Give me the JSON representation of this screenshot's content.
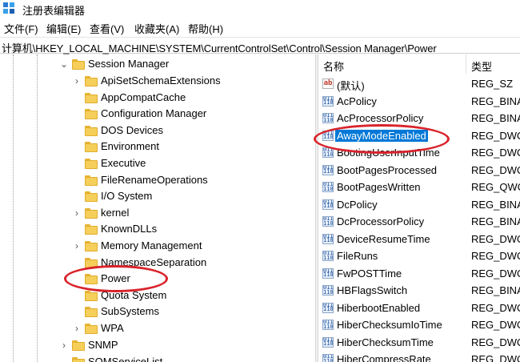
{
  "window": {
    "title": "注册表编辑器"
  },
  "menu": [
    "文件(F)",
    "编辑(E)",
    "查看(V)",
    "收藏夹(A)",
    "帮助(H)"
  ],
  "address": "计算机\\HKEY_LOCAL_MACHINE\\SYSTEM\\CurrentControlSet\\Control\\Session Manager\\Power",
  "tree": {
    "parent": "Session Manager",
    "children": [
      {
        "label": "ApiSetSchemaExtensions",
        "expandable": true
      },
      {
        "label": "AppCompatCache",
        "expandable": false
      },
      {
        "label": "Configuration Manager",
        "expandable": false
      },
      {
        "label": "DOS Devices",
        "expandable": false
      },
      {
        "label": "Environment",
        "expandable": false
      },
      {
        "label": "Executive",
        "expandable": false
      },
      {
        "label": "FileRenameOperations",
        "expandable": false
      },
      {
        "label": "I/O System",
        "expandable": false
      },
      {
        "label": "kernel",
        "expandable": true
      },
      {
        "label": "KnownDLLs",
        "expandable": false
      },
      {
        "label": "Memory Management",
        "expandable": true
      },
      {
        "label": "NamespaceSeparation",
        "expandable": false
      },
      {
        "label": "Power",
        "expandable": false
      },
      {
        "label": "Quota System",
        "expandable": false
      },
      {
        "label": "SubSystems",
        "expandable": false
      },
      {
        "label": "WPA",
        "expandable": true
      }
    ],
    "siblings": [
      "SNMP",
      "SQMServiceList"
    ]
  },
  "values": {
    "headers": {
      "name": "名称",
      "type": "类型"
    },
    "rows": [
      {
        "name": "(默认)",
        "type": "REG_SZ",
        "icon": "string-value-icon"
      },
      {
        "name": "AcPolicy",
        "type": "REG_BINA",
        "icon": "binary-value-icon"
      },
      {
        "name": "AcProcessorPolicy",
        "type": "REG_BINA",
        "icon": "binary-value-icon"
      },
      {
        "name": "AwayModeEnabled",
        "type": "REG_DWO",
        "icon": "binary-value-icon",
        "selected": true
      },
      {
        "name": "BootingUserInputTime",
        "type": "REG_DWO",
        "icon": "binary-value-icon"
      },
      {
        "name": "BootPagesProcessed",
        "type": "REG_DWO",
        "icon": "binary-value-icon"
      },
      {
        "name": "BootPagesWritten",
        "type": "REG_QWO",
        "icon": "binary-value-icon"
      },
      {
        "name": "DcPolicy",
        "type": "REG_BINA",
        "icon": "binary-value-icon"
      },
      {
        "name": "DcProcessorPolicy",
        "type": "REG_BINA",
        "icon": "binary-value-icon"
      },
      {
        "name": "DeviceResumeTime",
        "type": "REG_DWO",
        "icon": "binary-value-icon"
      },
      {
        "name": "FileRuns",
        "type": "REG_DWO",
        "icon": "binary-value-icon"
      },
      {
        "name": "FwPOSTTime",
        "type": "REG_DWO",
        "icon": "binary-value-icon"
      },
      {
        "name": "HBFlagsSwitch",
        "type": "REG_BINA",
        "icon": "binary-value-icon"
      },
      {
        "name": "HiberbootEnabled",
        "type": "REG_DWO",
        "icon": "binary-value-icon"
      },
      {
        "name": "HiberChecksumIoTime",
        "type": "REG_DWO",
        "icon": "binary-value-icon"
      },
      {
        "name": "HiberChecksumTime",
        "type": "REG_DWO",
        "icon": "binary-value-icon"
      },
      {
        "name": "HiberCompressRate",
        "type": "REG_DWO",
        "icon": "binary-value-icon"
      }
    ]
  },
  "colors": {
    "selection": "#0078d7",
    "annotation": "#d9232b",
    "folder": "#f6cf5a"
  }
}
